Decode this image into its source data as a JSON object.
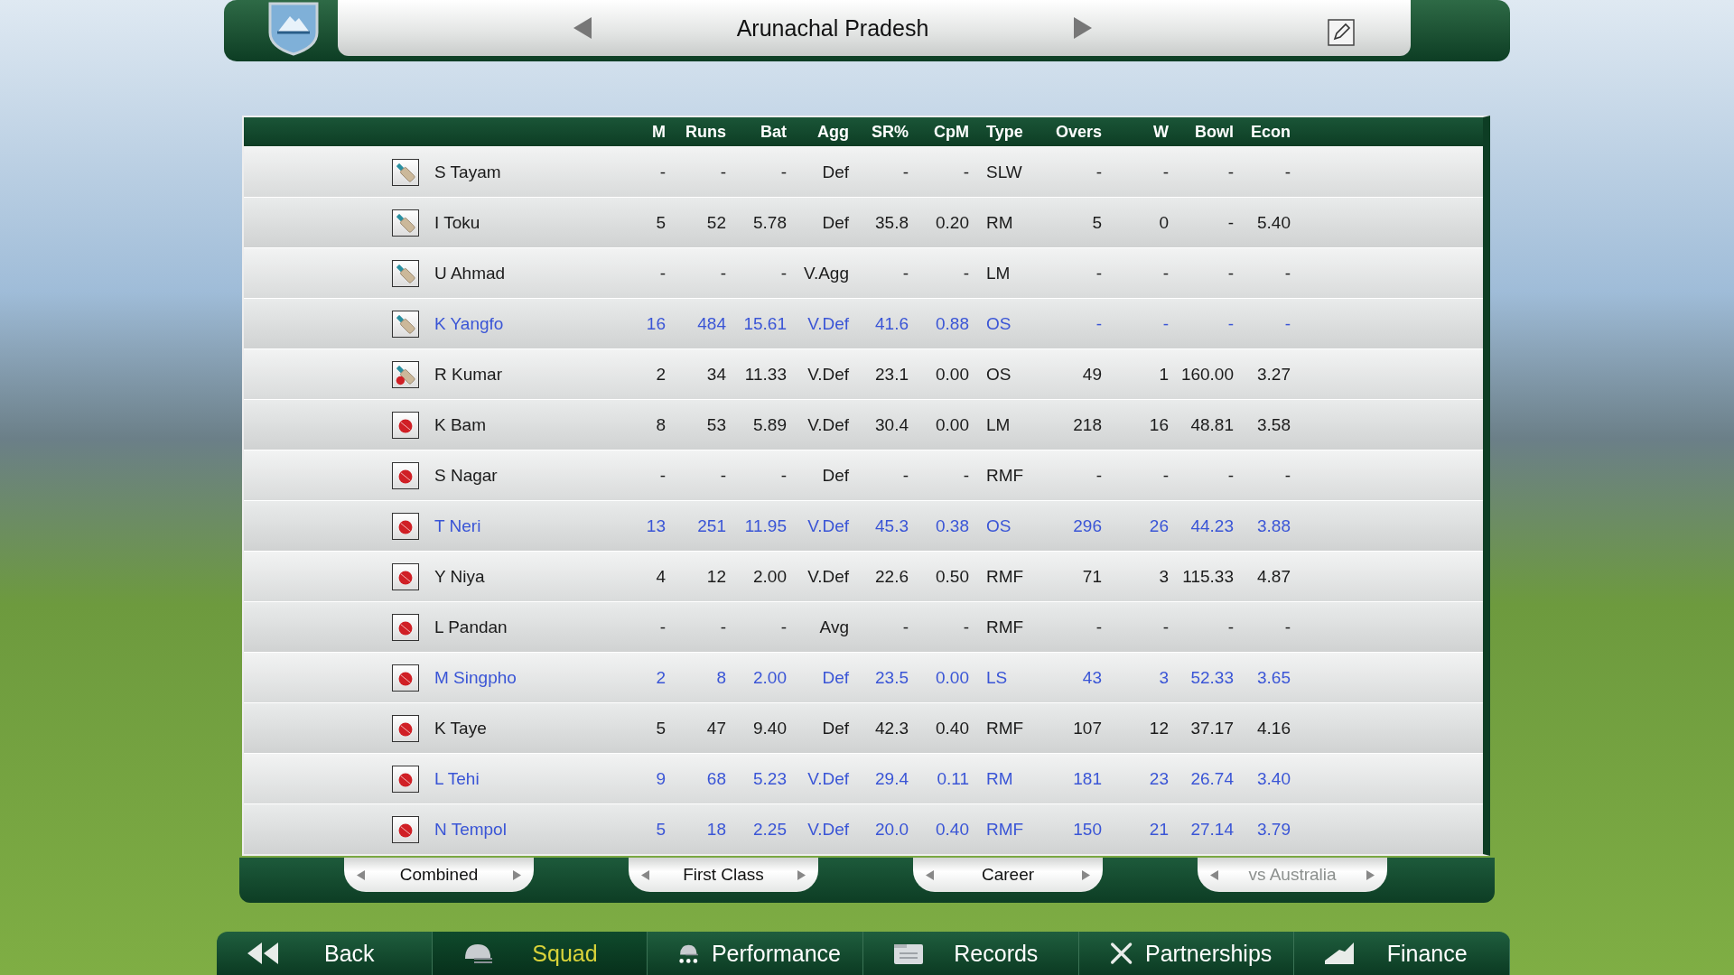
{
  "header": {
    "team": "Arunachal Pradesh"
  },
  "table": {
    "columns": [
      "M",
      "Runs",
      "Bat",
      "Agg",
      "SR%",
      "CpM",
      "Type",
      "Overs",
      "W",
      "Bowl",
      "Econ"
    ],
    "rows": [
      {
        "kind": "bat",
        "name": "S Tayam",
        "highlighted": false,
        "cells": [
          "-",
          "-",
          "-",
          "Def",
          "-",
          "-",
          "SLW",
          "-",
          "-",
          "-",
          "-"
        ]
      },
      {
        "kind": "bat",
        "name": "I Toku",
        "highlighted": false,
        "cells": [
          "5",
          "52",
          "5.78",
          "Def",
          "35.8",
          "0.20",
          "RM",
          "5",
          "0",
          "-",
          "5.40"
        ]
      },
      {
        "kind": "bat",
        "name": "U Ahmad",
        "highlighted": false,
        "cells": [
          "-",
          "-",
          "-",
          "V.Agg",
          "-",
          "-",
          "LM",
          "-",
          "-",
          "-",
          "-"
        ]
      },
      {
        "kind": "bat",
        "name": "K Yangfo",
        "highlighted": true,
        "cells": [
          "16",
          "484",
          "15.61",
          "V.Def",
          "41.6",
          "0.88",
          "OS",
          "-",
          "-",
          "-",
          "-"
        ]
      },
      {
        "kind": "allrounder",
        "name": "R Kumar",
        "highlighted": false,
        "cells": [
          "2",
          "34",
          "11.33",
          "V.Def",
          "23.1",
          "0.00",
          "OS",
          "49",
          "1",
          "160.00",
          "3.27"
        ]
      },
      {
        "kind": "ball",
        "name": "K Bam",
        "highlighted": false,
        "cells": [
          "8",
          "53",
          "5.89",
          "V.Def",
          "30.4",
          "0.00",
          "LM",
          "218",
          "16",
          "48.81",
          "3.58"
        ]
      },
      {
        "kind": "ball",
        "name": "S Nagar",
        "highlighted": false,
        "cells": [
          "-",
          "-",
          "-",
          "Def",
          "-",
          "-",
          "RMF",
          "-",
          "-",
          "-",
          "-"
        ]
      },
      {
        "kind": "ball",
        "name": "T Neri",
        "highlighted": true,
        "cells": [
          "13",
          "251",
          "11.95",
          "V.Def",
          "45.3",
          "0.38",
          "OS",
          "296",
          "26",
          "44.23",
          "3.88"
        ]
      },
      {
        "kind": "ball",
        "name": "Y Niya",
        "highlighted": false,
        "cells": [
          "4",
          "12",
          "2.00",
          "V.Def",
          "22.6",
          "0.50",
          "RMF",
          "71",
          "3",
          "115.33",
          "4.87"
        ]
      },
      {
        "kind": "ball",
        "name": "L Pandan",
        "highlighted": false,
        "cells": [
          "-",
          "-",
          "-",
          "Avg",
          "-",
          "-",
          "RMF",
          "-",
          "-",
          "-",
          "-"
        ]
      },
      {
        "kind": "ball",
        "name": "M Singpho",
        "highlighted": true,
        "cells": [
          "2",
          "8",
          "2.00",
          "Def",
          "23.5",
          "0.00",
          "LS",
          "43",
          "3",
          "52.33",
          "3.65"
        ]
      },
      {
        "kind": "ball",
        "name": "K Taye",
        "highlighted": false,
        "cells": [
          "5",
          "47",
          "9.40",
          "Def",
          "42.3",
          "0.40",
          "RMF",
          "107",
          "12",
          "37.17",
          "4.16"
        ]
      },
      {
        "kind": "ball",
        "name": "L Tehi",
        "highlighted": true,
        "cells": [
          "9",
          "68",
          "5.23",
          "V.Def",
          "29.4",
          "0.11",
          "RM",
          "181",
          "23",
          "26.74",
          "3.40"
        ]
      },
      {
        "kind": "ball",
        "name": "N Tempol",
        "highlighted": true,
        "cells": [
          "5",
          "18",
          "2.25",
          "V.Def",
          "20.0",
          "0.40",
          "RMF",
          "150",
          "21",
          "27.14",
          "3.79"
        ]
      }
    ]
  },
  "filters": [
    {
      "label": "Combined",
      "disabled": false
    },
    {
      "label": "First Class",
      "disabled": false
    },
    {
      "label": "Career",
      "disabled": false
    },
    {
      "label": "vs Australia",
      "disabled": true
    }
  ],
  "nav": [
    {
      "kind": "back",
      "label": "Back",
      "selected": false
    },
    {
      "kind": "squad",
      "label": "Squad",
      "selected": true
    },
    {
      "kind": "performance",
      "label": "Performance",
      "selected": false
    },
    {
      "kind": "records",
      "label": "Records",
      "selected": false
    },
    {
      "kind": "partnerships",
      "label": "Partnerships",
      "selected": false
    },
    {
      "kind": "finance",
      "label": "Finance",
      "selected": false
    }
  ]
}
